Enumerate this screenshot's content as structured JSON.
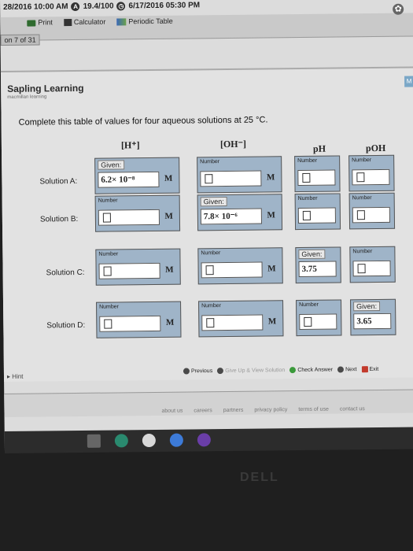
{
  "topbar": {
    "date_left": "28/2016 10:00 AM",
    "score": "19.4/100",
    "due": "6/17/2016 05:30 PM",
    "print_label": "Print",
    "calculator_label": "Calculator",
    "periodic_table_label": "Periodic Table",
    "counter": "on 7 of 31"
  },
  "brand": {
    "name": "Sapling Learning",
    "tagline": "macmillan learning"
  },
  "side_tag": "M",
  "question": "Complete this table of values for four aqueous solutions at 25 °C.",
  "columns": [
    "[H⁺]",
    "[OH⁻]",
    "pH",
    "pOH"
  ],
  "rows": [
    {
      "label": "Solution A:",
      "h": {
        "header": "Given:",
        "value": "6.2× 10⁻⁸",
        "unit": "M",
        "given": true
      },
      "oh": {
        "header": "Number",
        "value": "",
        "unit": "M",
        "given": false
      },
      "ph": {
        "header": "Number",
        "value": "",
        "given": false
      },
      "poh": {
        "header": "Number",
        "value": "",
        "given": false
      }
    },
    {
      "label": "Solution B:",
      "h": {
        "header": "Number",
        "value": "",
        "unit": "M",
        "given": false
      },
      "oh": {
        "header": "Given:",
        "value": "7.8× 10⁻⁶",
        "unit": "M",
        "given": true
      },
      "ph": {
        "header": "Number",
        "value": "",
        "given": false
      },
      "poh": {
        "header": "Number",
        "value": "",
        "given": false
      }
    },
    {
      "label": "Solution C:",
      "h": {
        "header": "Number",
        "value": "",
        "unit": "M",
        "given": false
      },
      "oh": {
        "header": "Number",
        "value": "",
        "unit": "M",
        "given": false
      },
      "ph": {
        "header": "Given:",
        "value": "3.75",
        "given": true
      },
      "poh": {
        "header": "Number",
        "value": "",
        "given": false
      }
    },
    {
      "label": "Solution D:",
      "h": {
        "header": "Number",
        "value": "",
        "unit": "M",
        "given": false
      },
      "oh": {
        "header": "Number",
        "value": "",
        "unit": "M",
        "given": false
      },
      "ph": {
        "header": "Number",
        "value": "",
        "given": false
      },
      "poh": {
        "header": "Given:",
        "value": "3.65",
        "given": true
      }
    }
  ],
  "actions": {
    "previous": "Previous",
    "give_up": "Give Up & View Solution",
    "check": "Check Answer",
    "next": "Next",
    "exit": "Exit"
  },
  "hint": "Hint",
  "footer_links": [
    "about us",
    "careers",
    "partners",
    "privacy policy",
    "terms of use",
    "contact us"
  ],
  "monitor_logo": "DELL"
}
